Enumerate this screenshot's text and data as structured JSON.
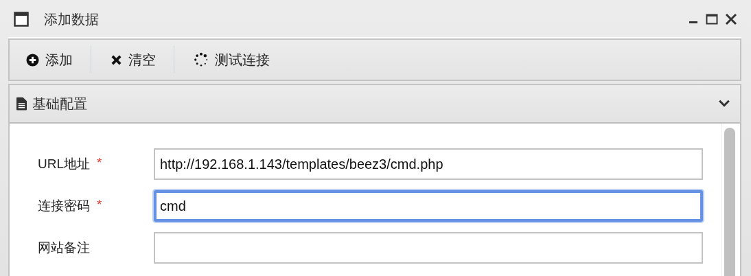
{
  "window": {
    "title": "添加数据"
  },
  "toolbar": [
    {
      "kind": "add",
      "label": "添加"
    },
    {
      "kind": "clear",
      "label": "清空"
    },
    {
      "kind": "test",
      "label": "测试连接"
    }
  ],
  "section": {
    "title": "基础配置"
  },
  "fields": [
    {
      "label": "URL地址",
      "required_mark": "*",
      "value": "http://192.168.1.143/templates/beez3/cmd.php",
      "focused": false
    },
    {
      "label": "连接密码",
      "required_mark": "*",
      "value": "cmd",
      "focused": true
    },
    {
      "label": "网站备注",
      "focused": false
    }
  ]
}
